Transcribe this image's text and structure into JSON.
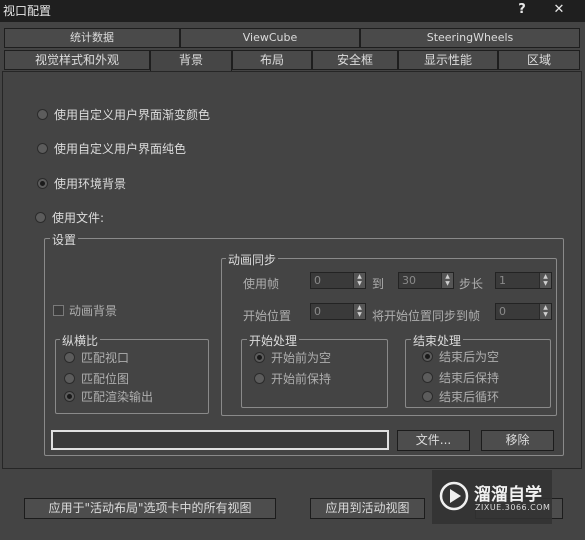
{
  "window": {
    "title": "视口配置",
    "help_glyph": "?",
    "close_glyph": "✕"
  },
  "tabs_row1": [
    "统计数据",
    "ViewCube",
    "SteeringWheels"
  ],
  "tabs_row2": [
    "视觉样式和外观",
    "背景",
    "布局",
    "安全框",
    "显示性能",
    "区域"
  ],
  "active_tab": "背景",
  "background_options": [
    {
      "label": "使用自定义用户界面渐变颜色",
      "selected": false
    },
    {
      "label": "使用自定义用户界面纯色",
      "selected": false
    },
    {
      "label": "使用环境背景",
      "selected": true
    },
    {
      "label": "使用文件:",
      "selected": false
    }
  ],
  "settings": {
    "title": "设置",
    "animate_bg_label": "动画背景",
    "aspect": {
      "title": "纵横比",
      "options": [
        {
          "label": "匹配视口",
          "selected": false
        },
        {
          "label": "匹配位图",
          "selected": false
        },
        {
          "label": "匹配渲染输出",
          "selected": true
        }
      ]
    },
    "anim_sync": {
      "title": "动画同步",
      "use_frames_label": "使用帧",
      "frame_from": "0",
      "to_label": "到",
      "frame_to": "30",
      "step_label": "步长",
      "step": "1",
      "start_pos_label": "开始位置",
      "start_pos": "0",
      "sync_label": "将开始位置同步到帧",
      "sync_frame": "0",
      "start_proc": {
        "title": "开始处理",
        "options": [
          {
            "label": "开始前为空",
            "selected": true
          },
          {
            "label": "开始前保持",
            "selected": false
          }
        ]
      },
      "end_proc": {
        "title": "结束处理",
        "options": [
          {
            "label": "结束后为空",
            "selected": true
          },
          {
            "label": "结束后保持",
            "selected": false
          },
          {
            "label": "结束后循环",
            "selected": false
          }
        ]
      }
    },
    "file_path": "",
    "files_button": "文件...",
    "remove_button": "移除"
  },
  "bottom": {
    "apply_all": "应用于\"活动布局\"选项卡中的所有视图",
    "apply_active": "应用到活动视图"
  },
  "watermark": {
    "brand": "溜溜自学",
    "url": "ZIXUE.3066.COM"
  }
}
